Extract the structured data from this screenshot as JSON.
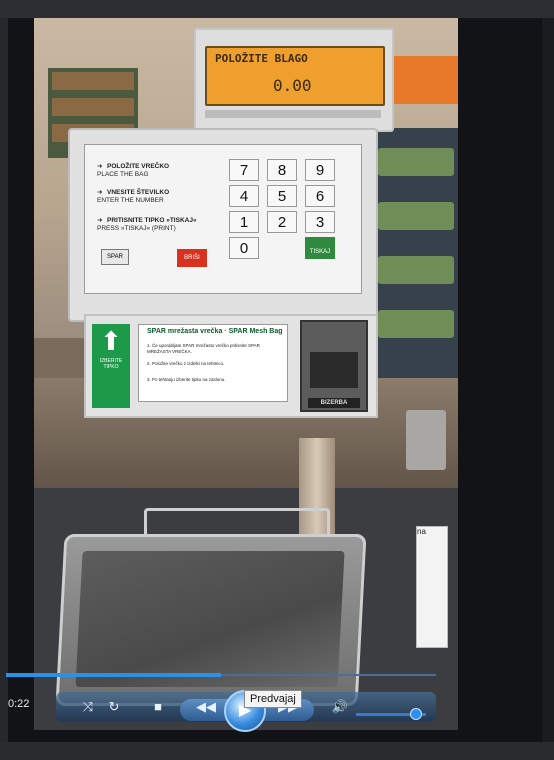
{
  "scale": {
    "display_message": "POLOŽITE BLAGO",
    "display_value": "0.00",
    "instructions": [
      {
        "title": "POLOŽITE VREČKO",
        "sub": "PLACE THE BAG"
      },
      {
        "title": "VNESITE ŠTEVILKO",
        "sub": "ENTER THE NUMBER"
      },
      {
        "title": "PRITISNITE TIPKO »TISKAJ«",
        "sub": "PRESS »TISKAJ« (PRINT)"
      }
    ],
    "keypad_keys": [
      "7",
      "8",
      "9",
      "4",
      "5",
      "6",
      "1",
      "2",
      "3",
      "0"
    ],
    "key_clear": "BRIŠI",
    "key_print": "TISKAJ",
    "key_bag": "SPAR",
    "bag_title": "SPAR mrežasta vrečka",
    "bag_title_en": "SPAR Mesh Bag",
    "bag_lines": [
      "1. Če uporabljate SPAR mrežasto vrečko pritisnite SPAR MREŽASTA VREČKA.",
      "2. Položite vrečko z izdelki na tehtnico.",
      "3. Po tehtanju izberite tipko na zaslonu."
    ],
    "select_label": "IZBERITE TIPKO",
    "dispenser_brand": "BIZERBA",
    "receipt_text": "na"
  },
  "player": {
    "time": "0:22",
    "tooltip": "Predvajaj",
    "progress_fraction": 0.5,
    "volume_fraction": 0.85,
    "icons": [
      "shuffle-icon",
      "repeat-icon",
      "stop-icon",
      "rewind-icon",
      "play-icon",
      "fast-forward-icon",
      "volume-icon"
    ]
  }
}
